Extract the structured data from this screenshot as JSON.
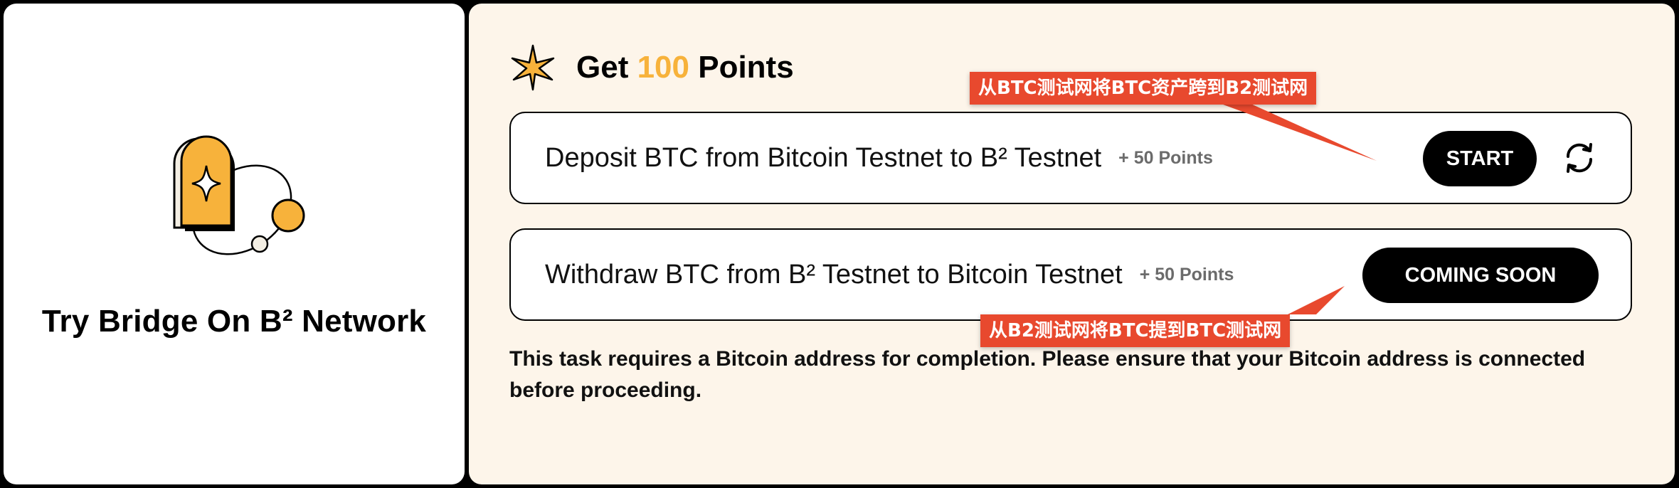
{
  "left_card": {
    "title": "Try Bridge On B² Network",
    "illustration_icon": "bridge-portal-illustration"
  },
  "header": {
    "title_prefix": "Get ",
    "points": "100",
    "title_suffix": " Points",
    "icon": "sparkle-star-icon"
  },
  "tasks": [
    {
      "text": "Deposit BTC from Bitcoin Testnet to B² Testnet",
      "points": "+ 50 Points",
      "button": "START",
      "refresh_icon": "refresh-icon"
    },
    {
      "text": "Withdraw BTC from B² Testnet to Bitcoin Testnet",
      "points": "+ 50 Points",
      "button": "COMING SOON"
    }
  ],
  "note": "This task requires a Bitcoin address for completion. Please ensure that your Bitcoin address is connected before proceeding.",
  "annotations": [
    "从BTC测试网将BTC资产跨到B2测试网",
    "从B2测试网将BTC提到BTC测试网"
  ],
  "colors": {
    "accent": "#f7b23b",
    "panel_bg": "#fdf5ea",
    "annotation": "#e8492e"
  }
}
